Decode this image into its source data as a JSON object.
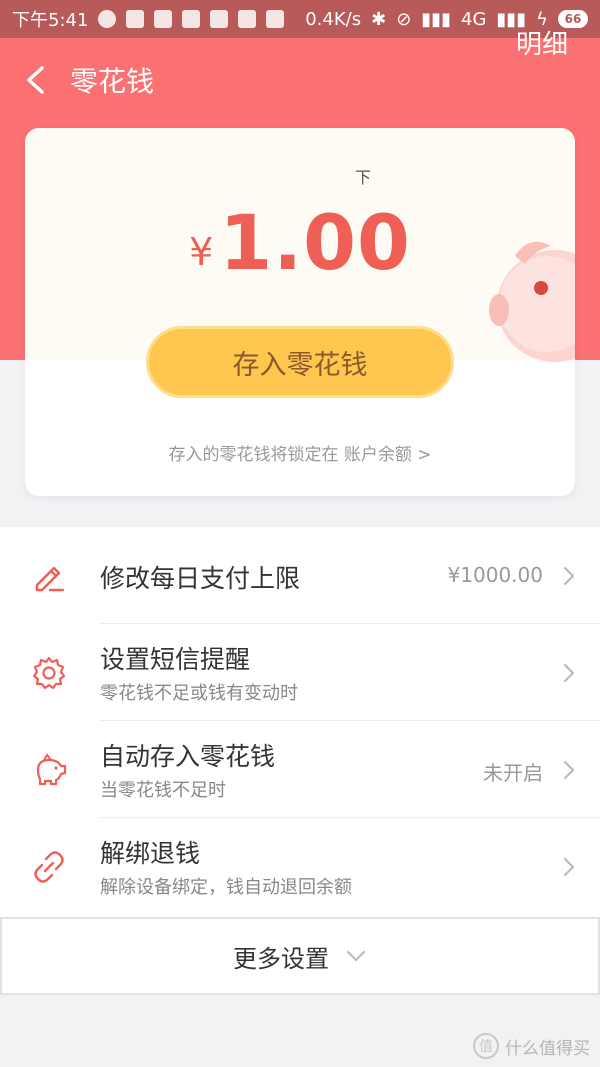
{
  "status_bar": {
    "time": "下午5:41",
    "net_speed": "0.4K/s",
    "network": "4G",
    "battery": "66"
  },
  "header": {
    "title": "零花钱",
    "detail_label": "明细"
  },
  "card": {
    "mark": "下",
    "currency": "¥",
    "amount": "1.00",
    "deposit_label": "存入零花钱",
    "note_text": "存入的零花钱将锁定在",
    "note_link": "账户余额 >"
  },
  "settings": [
    {
      "label": "修改每日支付上限",
      "sub": "",
      "value": "¥1000.00",
      "icon": "edit-icon"
    },
    {
      "label": "设置短信提醒",
      "sub": "零花钱不足或钱有变动时",
      "value": "",
      "icon": "gear-icon"
    },
    {
      "label": "自动存入零花钱",
      "sub": "当零花钱不足时",
      "value": "未开启",
      "icon": "piggy-bank-icon"
    },
    {
      "label": "解绑退钱",
      "sub": "解除设备绑定，钱自动退回余额",
      "value": "",
      "icon": "unlink-icon"
    }
  ],
  "more": {
    "label": "更多设置"
  },
  "watermark": {
    "logo": "值",
    "text": "什么值得买"
  },
  "colors": {
    "header_red": "#fb7070",
    "accent_red": "#ee5f55",
    "button_yellow": "#ffc750"
  }
}
